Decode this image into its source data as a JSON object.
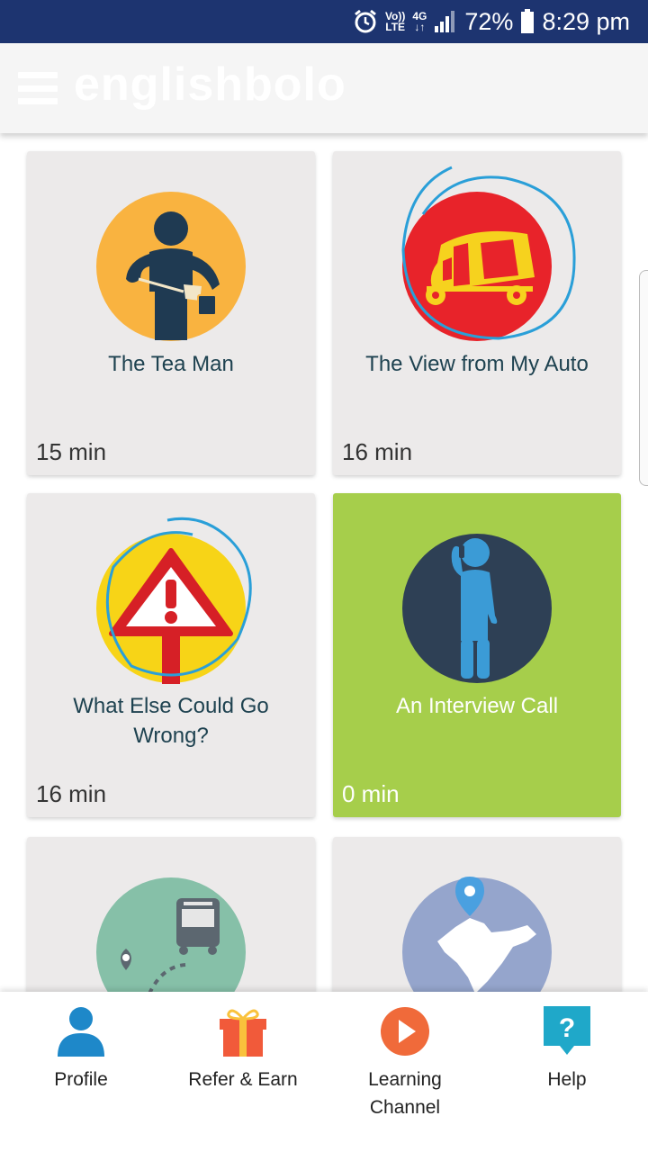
{
  "status_bar": {
    "network_top": "Vo))",
    "network_bottom": "LTE",
    "data_top": "4G",
    "data_bottom": "↓↑",
    "battery": "72%",
    "time": "8:29 pm"
  },
  "app_bar": {
    "brand": "englishbolo"
  },
  "cards": [
    {
      "title": "The Tea Man",
      "duration": "15 min"
    },
    {
      "title": "The View from My Auto",
      "duration": "16 min"
    },
    {
      "title": "What Else Could Go Wrong?",
      "duration": "16 min"
    },
    {
      "title": "An Interview Call",
      "duration": "0 min"
    },
    {
      "title": "",
      "duration": ""
    },
    {
      "title": "",
      "duration": ""
    }
  ],
  "bottom_nav": [
    {
      "label": "Profile"
    },
    {
      "label": "Refer & Earn"
    },
    {
      "label": "Learning\nChannel"
    },
    {
      "label": "Help"
    }
  ],
  "colors": {
    "status_bar": "#1d3470",
    "card_bg": "#eceaea",
    "card_active": "#a6ce4b",
    "title_text": "#1e4250"
  },
  "icons": [
    "alarm-icon",
    "signal-icon",
    "battery-icon",
    "menu-icon",
    "tea-man-icon",
    "auto-rickshaw-icon",
    "warning-sign-icon",
    "phone-call-person-icon",
    "bus-route-icon",
    "india-map-icon",
    "profile-icon",
    "gift-icon",
    "play-icon",
    "help-icon"
  ]
}
